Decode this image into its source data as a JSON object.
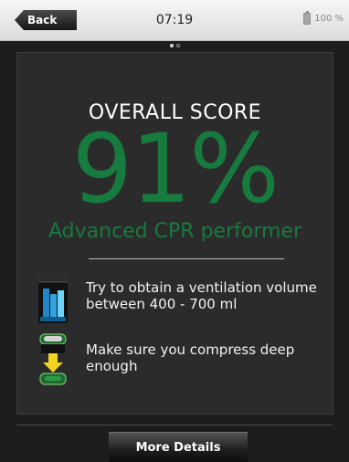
{
  "status_bar": {
    "back_label": "Back",
    "time": "07:19",
    "battery_text": "100 %",
    "battery_icon": "battery-icon"
  },
  "pager": {
    "pages": 2,
    "current": 1
  },
  "score": {
    "heading": "OVERALL SCORE",
    "value": "91%",
    "performer": "Advanced CPR performer",
    "accent_color": "#177a3e"
  },
  "tips": [
    {
      "icon": "ventilation-volume-icon",
      "text": "Try to obtain a ventilation volume between 400 - 700 ml"
    },
    {
      "icon": "compression-depth-icon",
      "text": "Make sure you compress deep enough"
    }
  ],
  "footer": {
    "more_details_label": "More Details"
  }
}
